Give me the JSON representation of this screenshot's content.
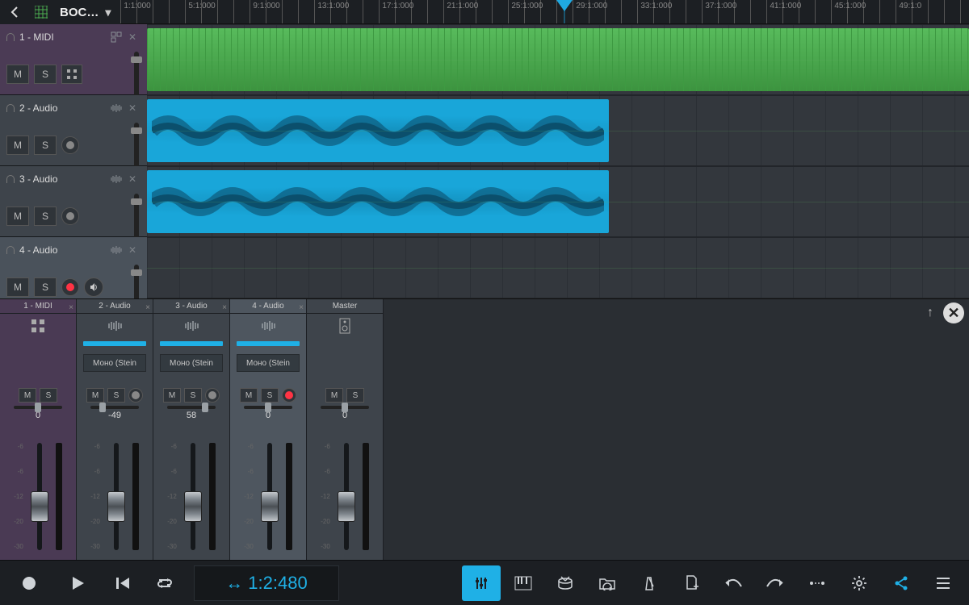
{
  "header": {
    "title": "BOC…"
  },
  "ruler": {
    "labels": [
      "1:1:000",
      "5:1:000",
      "9:1:000",
      "13:1:000",
      "17:1:000",
      "21:1:000",
      "25:1:000",
      "29:1:000",
      "33:1:000",
      "37:1:000",
      "41:1:000",
      "45:1:000",
      "49:1:0"
    ]
  },
  "playhead_bar": 28.5,
  "tracks": [
    {
      "label": "1 - MIDI",
      "type": "midi",
      "selected": false,
      "armed": false
    },
    {
      "label": "2 - Audio",
      "type": "audio",
      "selected": false,
      "armed": false
    },
    {
      "label": "3 - Audio",
      "type": "audio",
      "selected": false,
      "armed": false
    },
    {
      "label": "4 - Audio",
      "type": "audio",
      "selected": true,
      "armed": true
    }
  ],
  "mixer": {
    "send_label": "Моно (Stein",
    "db_marks": [
      "-6",
      "-6",
      "-12",
      "-20",
      "-30"
    ],
    "channels": [
      {
        "label": "1 - MIDI",
        "type": "midi",
        "pan": 0,
        "send": false,
        "armed": false,
        "fader": 0.55
      },
      {
        "label": "2 - Audio",
        "type": "audio",
        "pan": -49,
        "send": true,
        "armed": false,
        "fader": 0.55
      },
      {
        "label": "3 - Audio",
        "type": "audio",
        "pan": 58,
        "send": true,
        "armed": false,
        "fader": 0.55
      },
      {
        "label": "4 - Audio",
        "type": "audio",
        "pan": 0,
        "send": true,
        "armed": true,
        "fader": 0.55,
        "selected": true
      },
      {
        "label": "Master",
        "type": "master",
        "pan": 0,
        "send": false,
        "armed": false,
        "fader": 0.55
      }
    ]
  },
  "transport": {
    "position": "1:2:480",
    "buttons": {
      "record": "●",
      "play": "▶",
      "rewind": "|◀",
      "loop": "⟳"
    }
  },
  "btns": {
    "mute": "M",
    "solo": "S"
  }
}
